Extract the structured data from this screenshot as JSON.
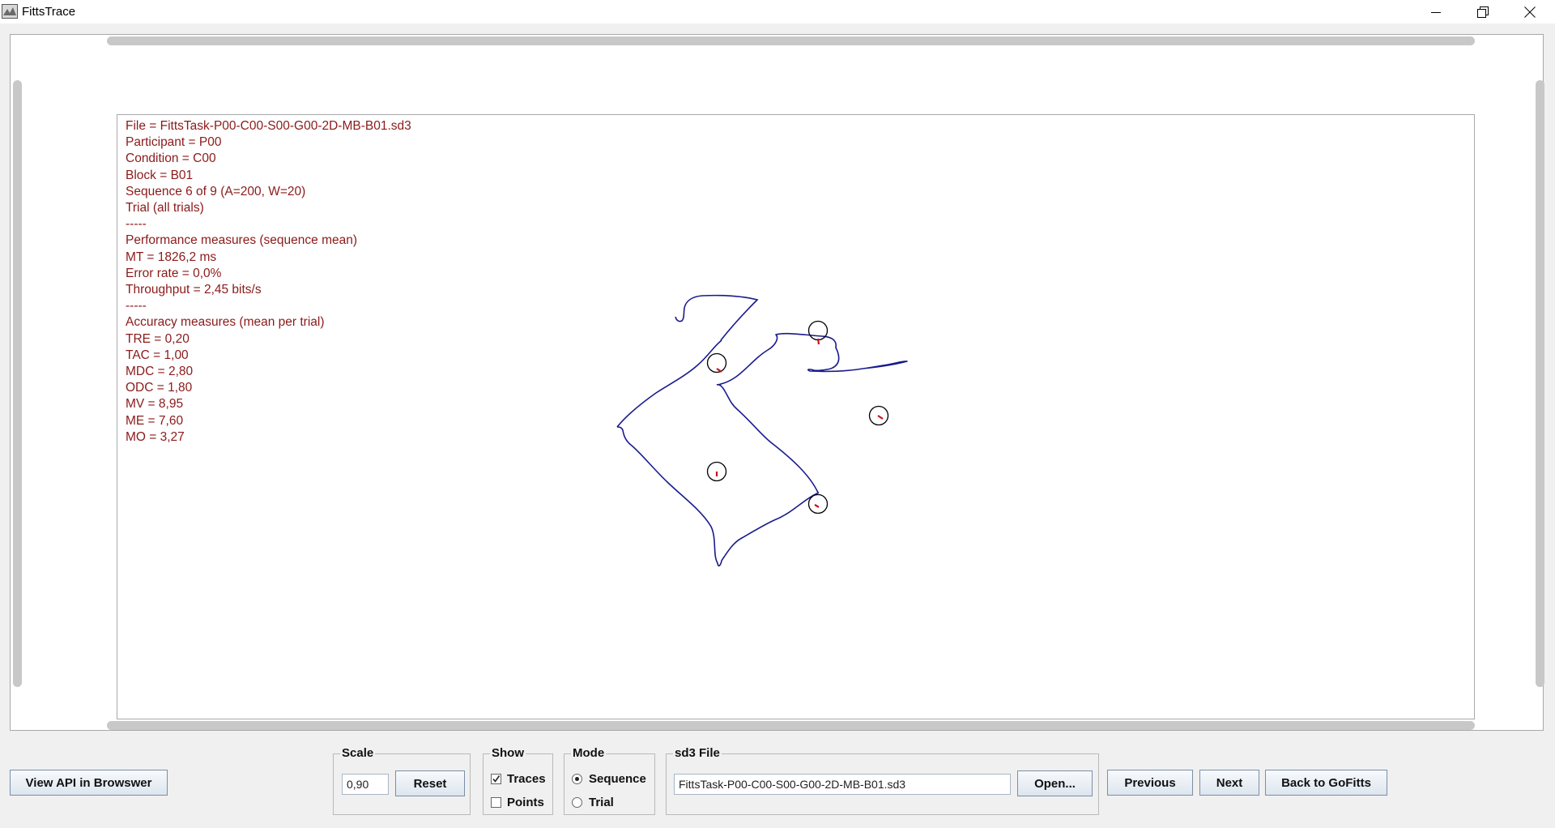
{
  "window": {
    "title": "FittsTrace",
    "minimize_icon": "minimize-icon",
    "restore_icon": "restore-icon",
    "close_icon": "close-icon"
  },
  "info_lines": [
    "File = FittsTask-P00-C00-S00-G00-2D-MB-B01.sd3",
    "Participant = P00",
    "Condition = C00",
    "Block = B01",
    "Sequence 6 of 9 (A=200, W=20)",
    "Trial (all trials)",
    "-----",
    "Performance measures (sequence mean)",
    "MT = 1826,2 ms",
    "Error rate = 0,0%",
    "Throughput = 2,45 bits/s",
    "-----",
    "Accuracy measures (mean per trial)",
    "TRE = 0,20",
    "TAC = 1,00",
    "MDC = 2,80",
    "ODC = 1,80",
    "MV = 8,95",
    "ME = 7,60",
    "MO = 3,27"
  ],
  "colors": {
    "info_text": "#8b1a1a",
    "trace": "#1a1a8c",
    "select_points": "#cc1122",
    "targets": "#000000"
  },
  "controls": {
    "view_api_label": "View API in Browswer",
    "scale": {
      "label": "Scale",
      "value": "0,90",
      "reset_label": "Reset"
    },
    "show": {
      "label": "Show",
      "traces_label": "Traces",
      "traces_checked": true,
      "points_label": "Points",
      "points_checked": false
    },
    "mode": {
      "label": "Mode",
      "sequence_label": "Sequence",
      "trial_label": "Trial",
      "selected": "Sequence"
    },
    "sd3": {
      "label": "sd3 File",
      "value": "FittsTask-P00-C00-S00-G00-2D-MB-B01.sd3",
      "open_label": "Open..."
    },
    "previous_label": "Previous",
    "next_label": "Next",
    "back_label": "Back to GoFitts"
  }
}
